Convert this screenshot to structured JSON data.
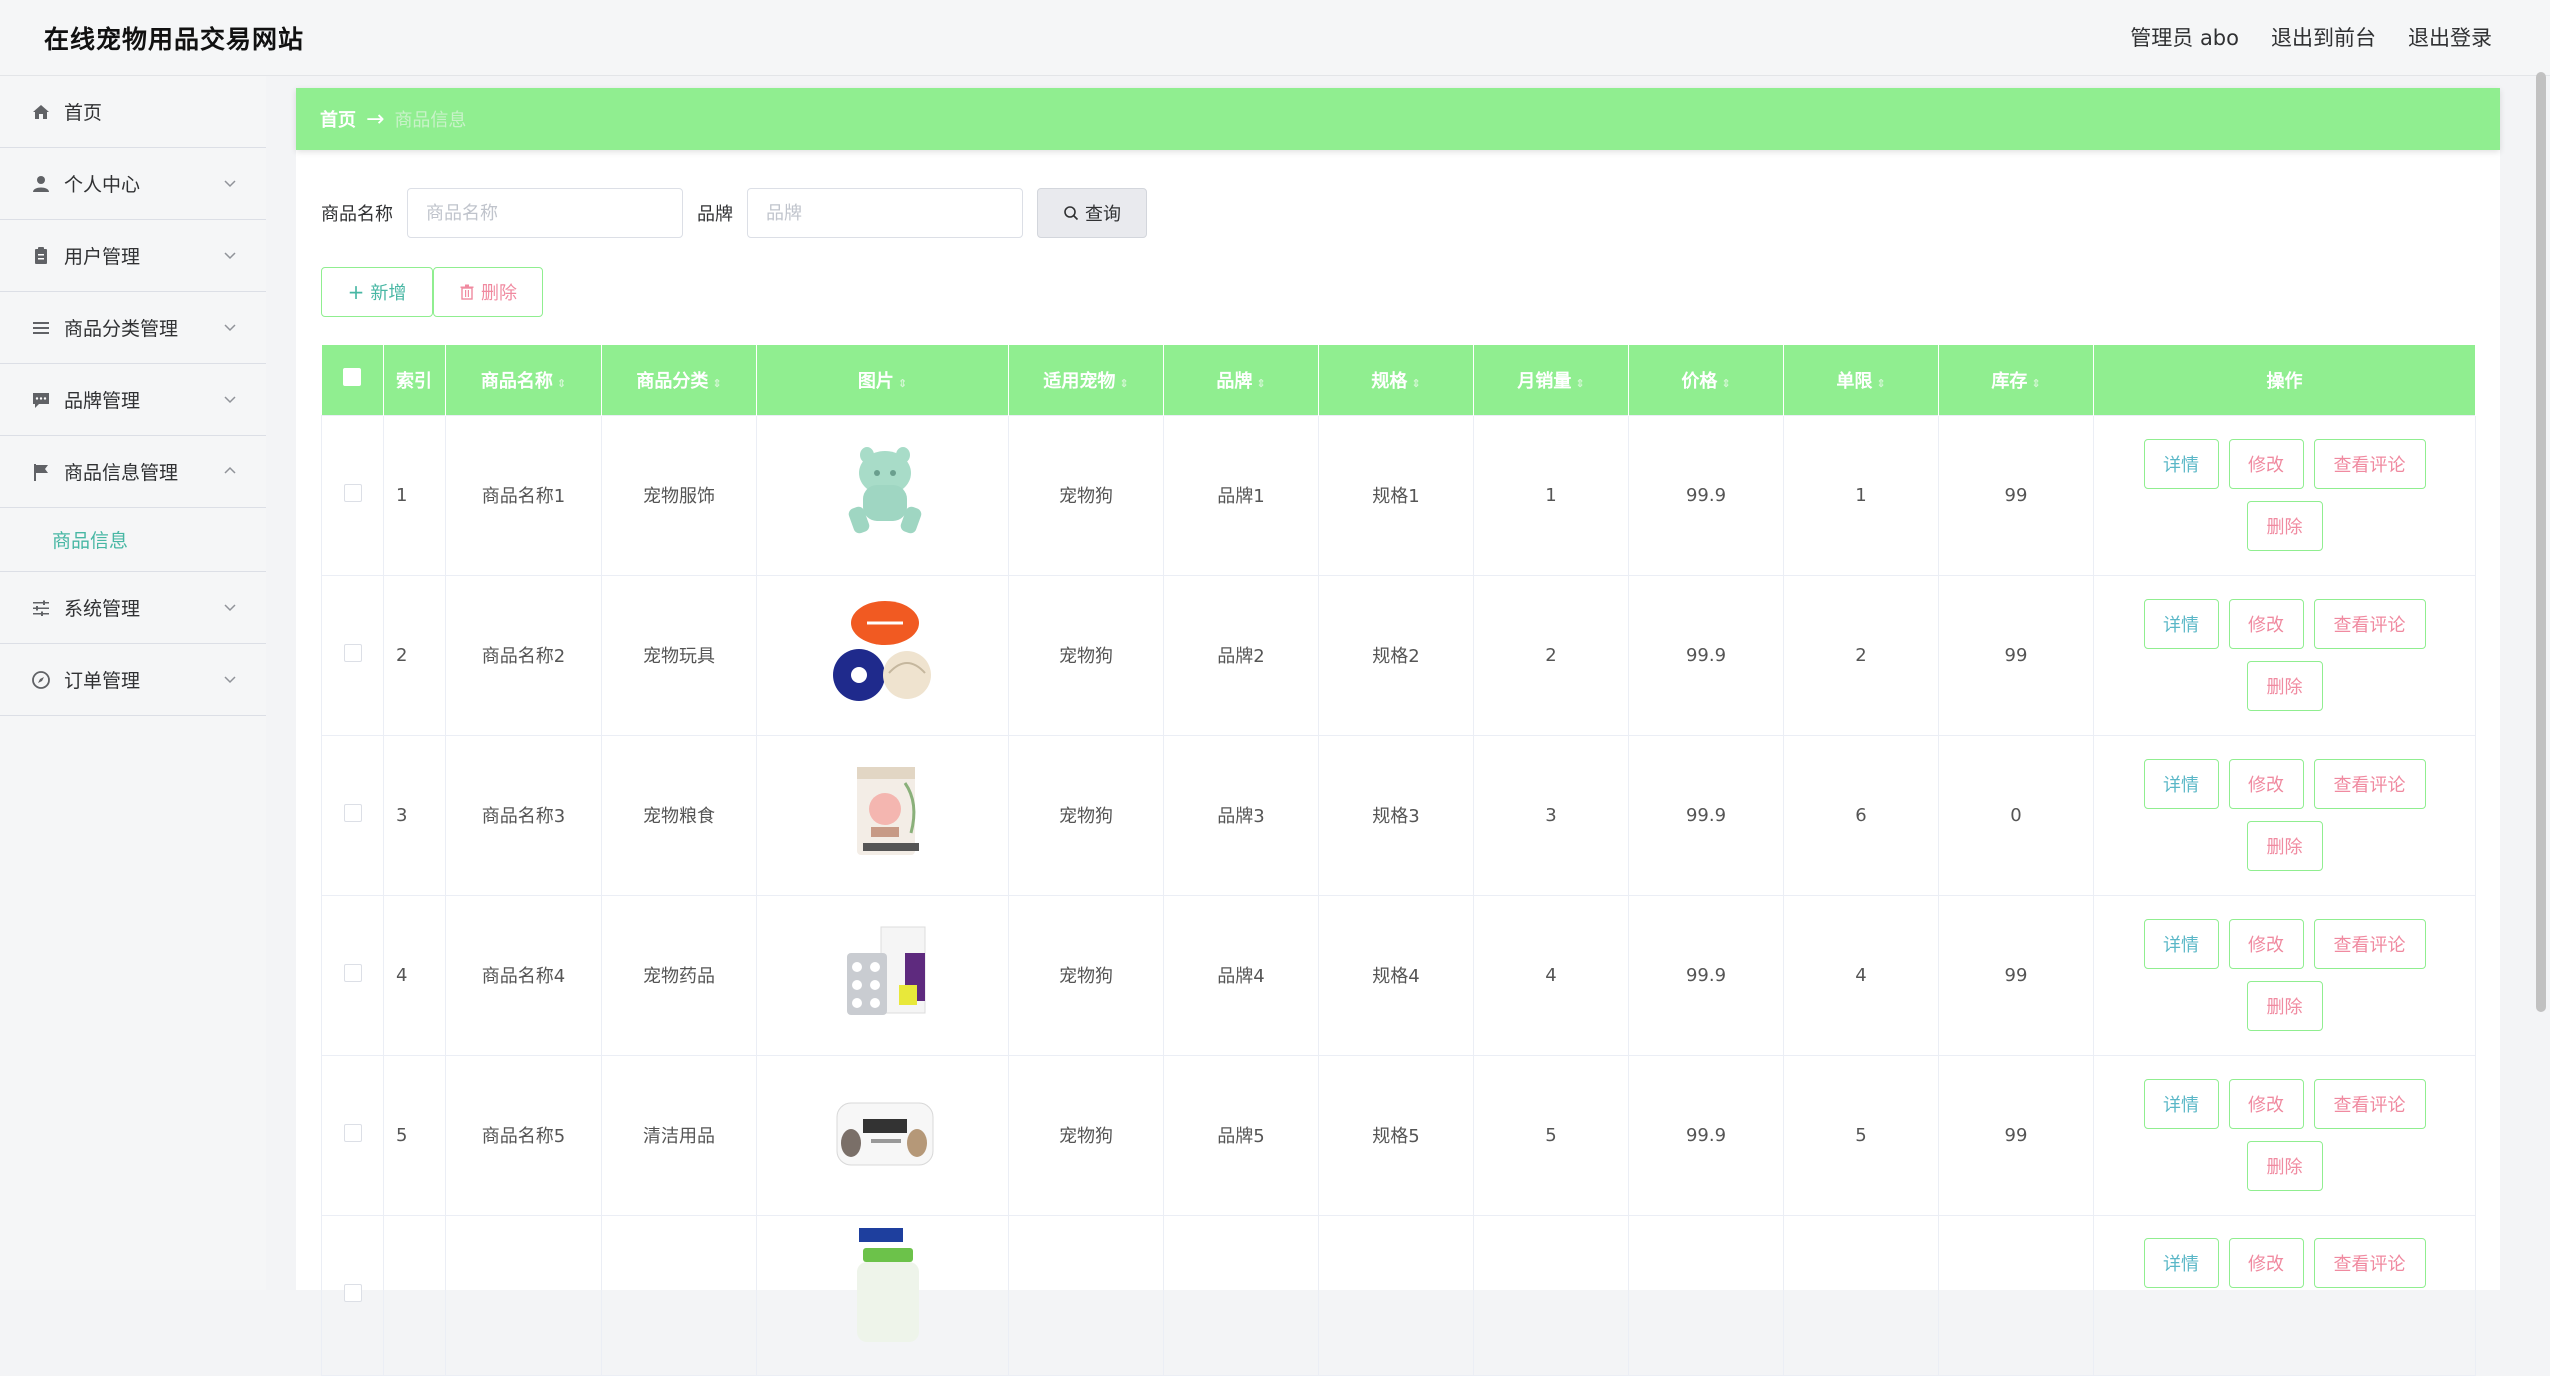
{
  "header": {
    "title": "在线宠物用品交易网站",
    "user": "管理员 abo",
    "front": "退出到前台",
    "logout": "退出登录"
  },
  "sidebar": {
    "items": [
      {
        "label": "首页",
        "icon": "home-icon"
      },
      {
        "label": "个人中心",
        "icon": "user-icon"
      },
      {
        "label": "用户管理",
        "icon": "clipboard-icon"
      },
      {
        "label": "商品分类管理",
        "icon": "list-icon"
      },
      {
        "label": "品牌管理",
        "icon": "chat-icon"
      },
      {
        "label": "商品信息管理",
        "icon": "flag-icon"
      },
      {
        "label": "系统管理",
        "icon": "sliders-icon"
      },
      {
        "label": "订单管理",
        "icon": "compass-icon"
      }
    ],
    "sub": "商品信息"
  },
  "breadcrumb": {
    "home": "首页",
    "arrow": "→",
    "current": "商品信息"
  },
  "search": {
    "name_label": "商品名称",
    "name_placeholder": "商品名称",
    "brand_label": "品牌",
    "brand_placeholder": "品牌",
    "query": "查询"
  },
  "actions": {
    "add": "新增",
    "delete": "删除"
  },
  "table": {
    "headers": [
      "索引",
      "商品名称",
      "商品分类",
      "图片",
      "适用宠物",
      "品牌",
      "规格",
      "月销量",
      "价格",
      "单限",
      "库存",
      "操作"
    ],
    "buttons": {
      "detail": "详情",
      "edit": "修改",
      "review": "查看评论",
      "delete": "删除"
    },
    "rows": [
      {
        "idx": "1",
        "name": "商品名称1",
        "cat": "宠物服饰",
        "pet": "宠物狗",
        "brand": "品牌1",
        "spec": "规格1",
        "sales": "1",
        "price": "99.9",
        "limit": "1",
        "stock": "99"
      },
      {
        "idx": "2",
        "name": "商品名称2",
        "cat": "宠物玩具",
        "pet": "宠物狗",
        "brand": "品牌2",
        "spec": "规格2",
        "sales": "2",
        "price": "99.9",
        "limit": "2",
        "stock": "99"
      },
      {
        "idx": "3",
        "name": "商品名称3",
        "cat": "宠物粮食",
        "pet": "宠物狗",
        "brand": "品牌3",
        "spec": "规格3",
        "sales": "3",
        "price": "99.9",
        "limit": "6",
        "stock": "0"
      },
      {
        "idx": "4",
        "name": "商品名称4",
        "cat": "宠物药品",
        "pet": "宠物狗",
        "brand": "品牌4",
        "spec": "规格4",
        "sales": "4",
        "price": "99.9",
        "limit": "4",
        "stock": "99"
      },
      {
        "idx": "5",
        "name": "商品名称5",
        "cat": "清洁用品",
        "pet": "宠物狗",
        "brand": "品牌5",
        "spec": "规格5",
        "sales": "5",
        "price": "99.9",
        "limit": "5",
        "stock": "99"
      }
    ]
  }
}
